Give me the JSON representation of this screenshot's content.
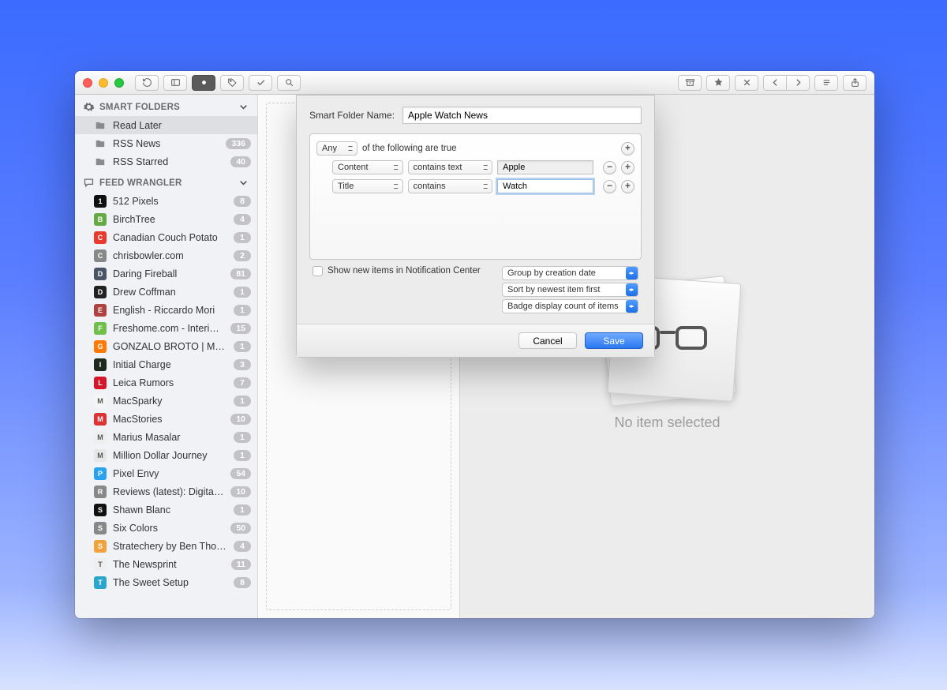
{
  "sidebar": {
    "smart_folders_header": "SMART FOLDERS",
    "feed_wrangler_header": "FEED WRANGLER",
    "smart_folders": [
      {
        "label": "Read Later",
        "badge": null,
        "selected": true
      },
      {
        "label": "RSS News",
        "badge": "336"
      },
      {
        "label": "RSS Starred",
        "badge": "40"
      }
    ],
    "feeds": [
      {
        "label": "512 Pixels",
        "badge": "8",
        "color": "#111"
      },
      {
        "label": "BirchTree",
        "badge": "4",
        "color": "#6a4"
      },
      {
        "label": "Canadian Couch Potato",
        "badge": "1",
        "color": "#e63b2e"
      },
      {
        "label": "chrisbowler.com",
        "badge": "2",
        "color": "#888"
      },
      {
        "label": "Daring Fireball",
        "badge": "81",
        "color": "#4a5568"
      },
      {
        "label": "Drew Coffman",
        "badge": "1",
        "color": "#222"
      },
      {
        "label": "English - Riccardo Mori",
        "badge": "1",
        "color": "#b0413e"
      },
      {
        "label": "Freshome.com - Interior Desig…",
        "badge": "15",
        "color": "#6fbf4a"
      },
      {
        "label": "GONZALO BROTO | MEMORYS…",
        "badge": "1",
        "color": "#ff7a00"
      },
      {
        "label": "Initial Charge",
        "badge": "3",
        "color": "#1e2a1e"
      },
      {
        "label": "Leica Rumors",
        "badge": "7",
        "color": "#d4172a"
      },
      {
        "label": "MacSparky",
        "badge": "1",
        "color": "#f5f5f5"
      },
      {
        "label": "MacStories",
        "badge": "10",
        "color": "#d33"
      },
      {
        "label": "Marius Masalar",
        "badge": "1",
        "color": "#eee"
      },
      {
        "label": "Million Dollar Journey",
        "badge": "1",
        "color": "#e6e6e6"
      },
      {
        "label": "Pixel Envy",
        "badge": "54",
        "color": "#2aa3ef"
      },
      {
        "label": "Reviews (latest): Digital Phot…",
        "badge": "10",
        "color": "#888"
      },
      {
        "label": "Shawn Blanc",
        "badge": "1",
        "color": "#111"
      },
      {
        "label": "Six Colors",
        "badge": "50",
        "color": "#888"
      },
      {
        "label": "Stratechery by Ben Thompson",
        "badge": "4",
        "color": "#f2a23c"
      },
      {
        "label": "The Newsprint",
        "badge": "11",
        "color": "#eee"
      },
      {
        "label": "The Sweet Setup",
        "badge": "8",
        "color": "#2aa5cc"
      }
    ]
  },
  "detail": {
    "empty_message": "No item selected"
  },
  "sheet": {
    "name_label": "Smart Folder Name:",
    "name_value": "Apple Watch News",
    "match_mode": "Any",
    "match_suffix": "of the following are true",
    "rules": [
      {
        "field": "Content",
        "predicate": "contains text",
        "value": "Apple",
        "value_state": "dim"
      },
      {
        "field": "Title",
        "predicate": "contains",
        "value": "Watch",
        "value_state": "focused"
      }
    ],
    "notify_label": "Show new items in Notification Center",
    "options": {
      "group": "Group by creation date",
      "sort": "Sort by newest item first",
      "badge": "Badge display count of items"
    },
    "buttons": {
      "cancel": "Cancel",
      "save": "Save"
    }
  }
}
